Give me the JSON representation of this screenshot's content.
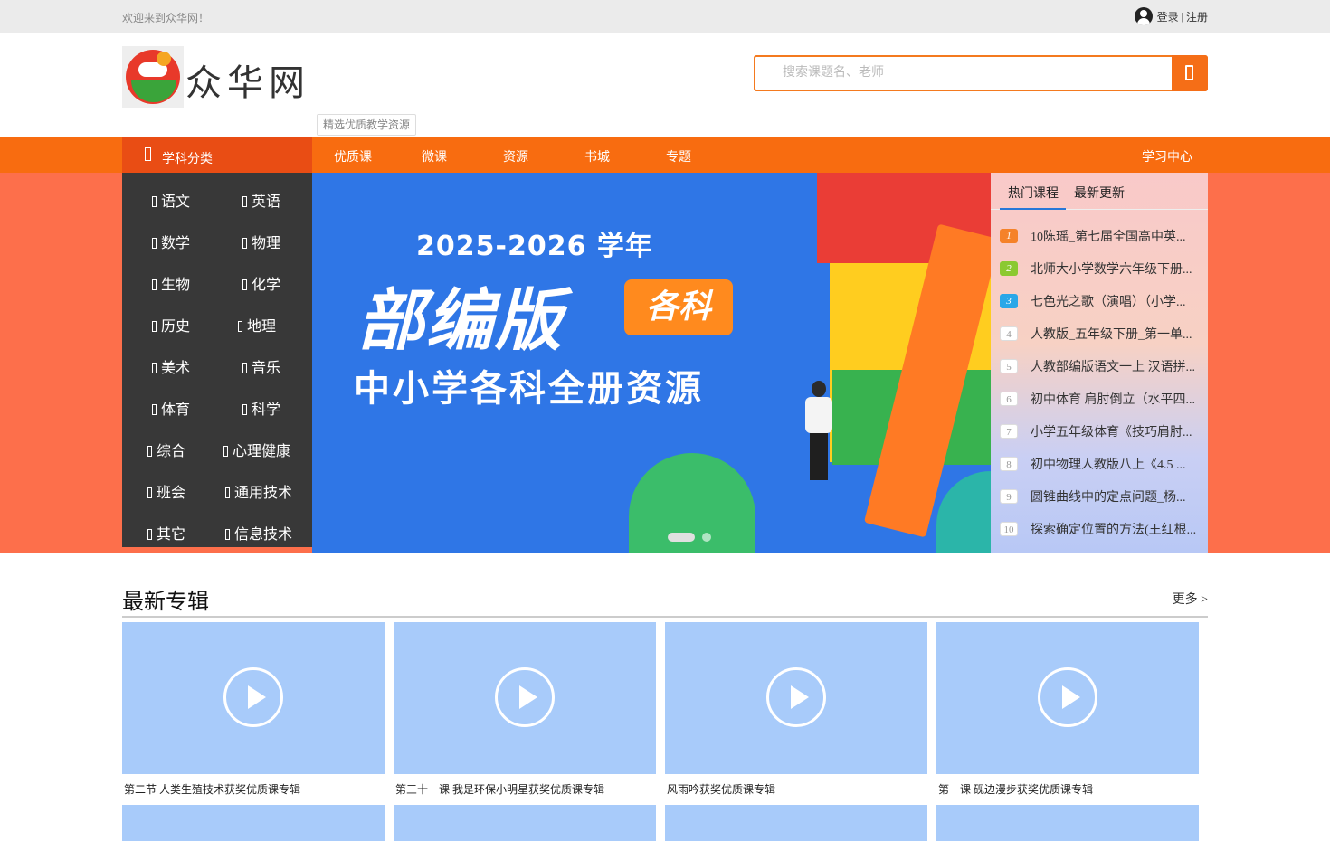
{
  "topbar": {
    "welcome": "欢迎来到众华网！",
    "login": "登录",
    "divider": "|",
    "register": "注册"
  },
  "header": {
    "logo_text": "众华网",
    "slogan": "精选优质教学资源",
    "search_placeholder": "搜索课题名、老师"
  },
  "nav": {
    "category_label": "学科分类",
    "items": [
      "优质课",
      "微课",
      "资源",
      "书城",
      "专题"
    ],
    "right": "学习中心"
  },
  "subjects": [
    [
      "语文",
      "英语"
    ],
    [
      "数学",
      "物理"
    ],
    [
      "生物",
      "化学"
    ],
    [
      "历史",
      "地理"
    ],
    [
      "美术",
      "音乐"
    ],
    [
      "体育",
      "科学"
    ],
    [
      "综合",
      "心理健康"
    ],
    [
      "班会",
      "通用技术"
    ],
    [
      "其它",
      "信息技术"
    ]
  ],
  "banner": {
    "year": "2025-2026 学年",
    "title": "部编版",
    "tag": "各科",
    "subtitle": "中小学各科全册资源"
  },
  "hot": {
    "tabs": [
      "热门课程",
      "最新更新"
    ],
    "items": [
      "10陈瑶_第七届全国高中英...",
      "北师大小学数学六年级下册...",
      "七色光之歌（演唱）（小学...",
      "人教版_五年级下册_第一单...",
      "人教部编版语文一上 汉语拼...",
      "初中体育 肩肘倒立（水平四...",
      "小学五年级体育《技巧肩肘...",
      "初中物理人教版八上《4.5 ...",
      "圆锥曲线中的定点问题_杨...",
      "探索确定位置的方法(王红根..."
    ]
  },
  "section": {
    "title": "最新专辑",
    "more": "更多 >",
    "cards": [
      "第二节 人类生殖技术获奖优质课专辑",
      "第三十一课 我是环保小明星获奖优质课专辑",
      "风雨吟获奖优质课专辑",
      "第一课 砚边漫步获奖优质课专辑"
    ]
  },
  "colors": {
    "accent": "#f86c10",
    "category_bg": "#383838",
    "banner_bg": "#fd6f4b",
    "thumb": "#a8cbfa"
  }
}
